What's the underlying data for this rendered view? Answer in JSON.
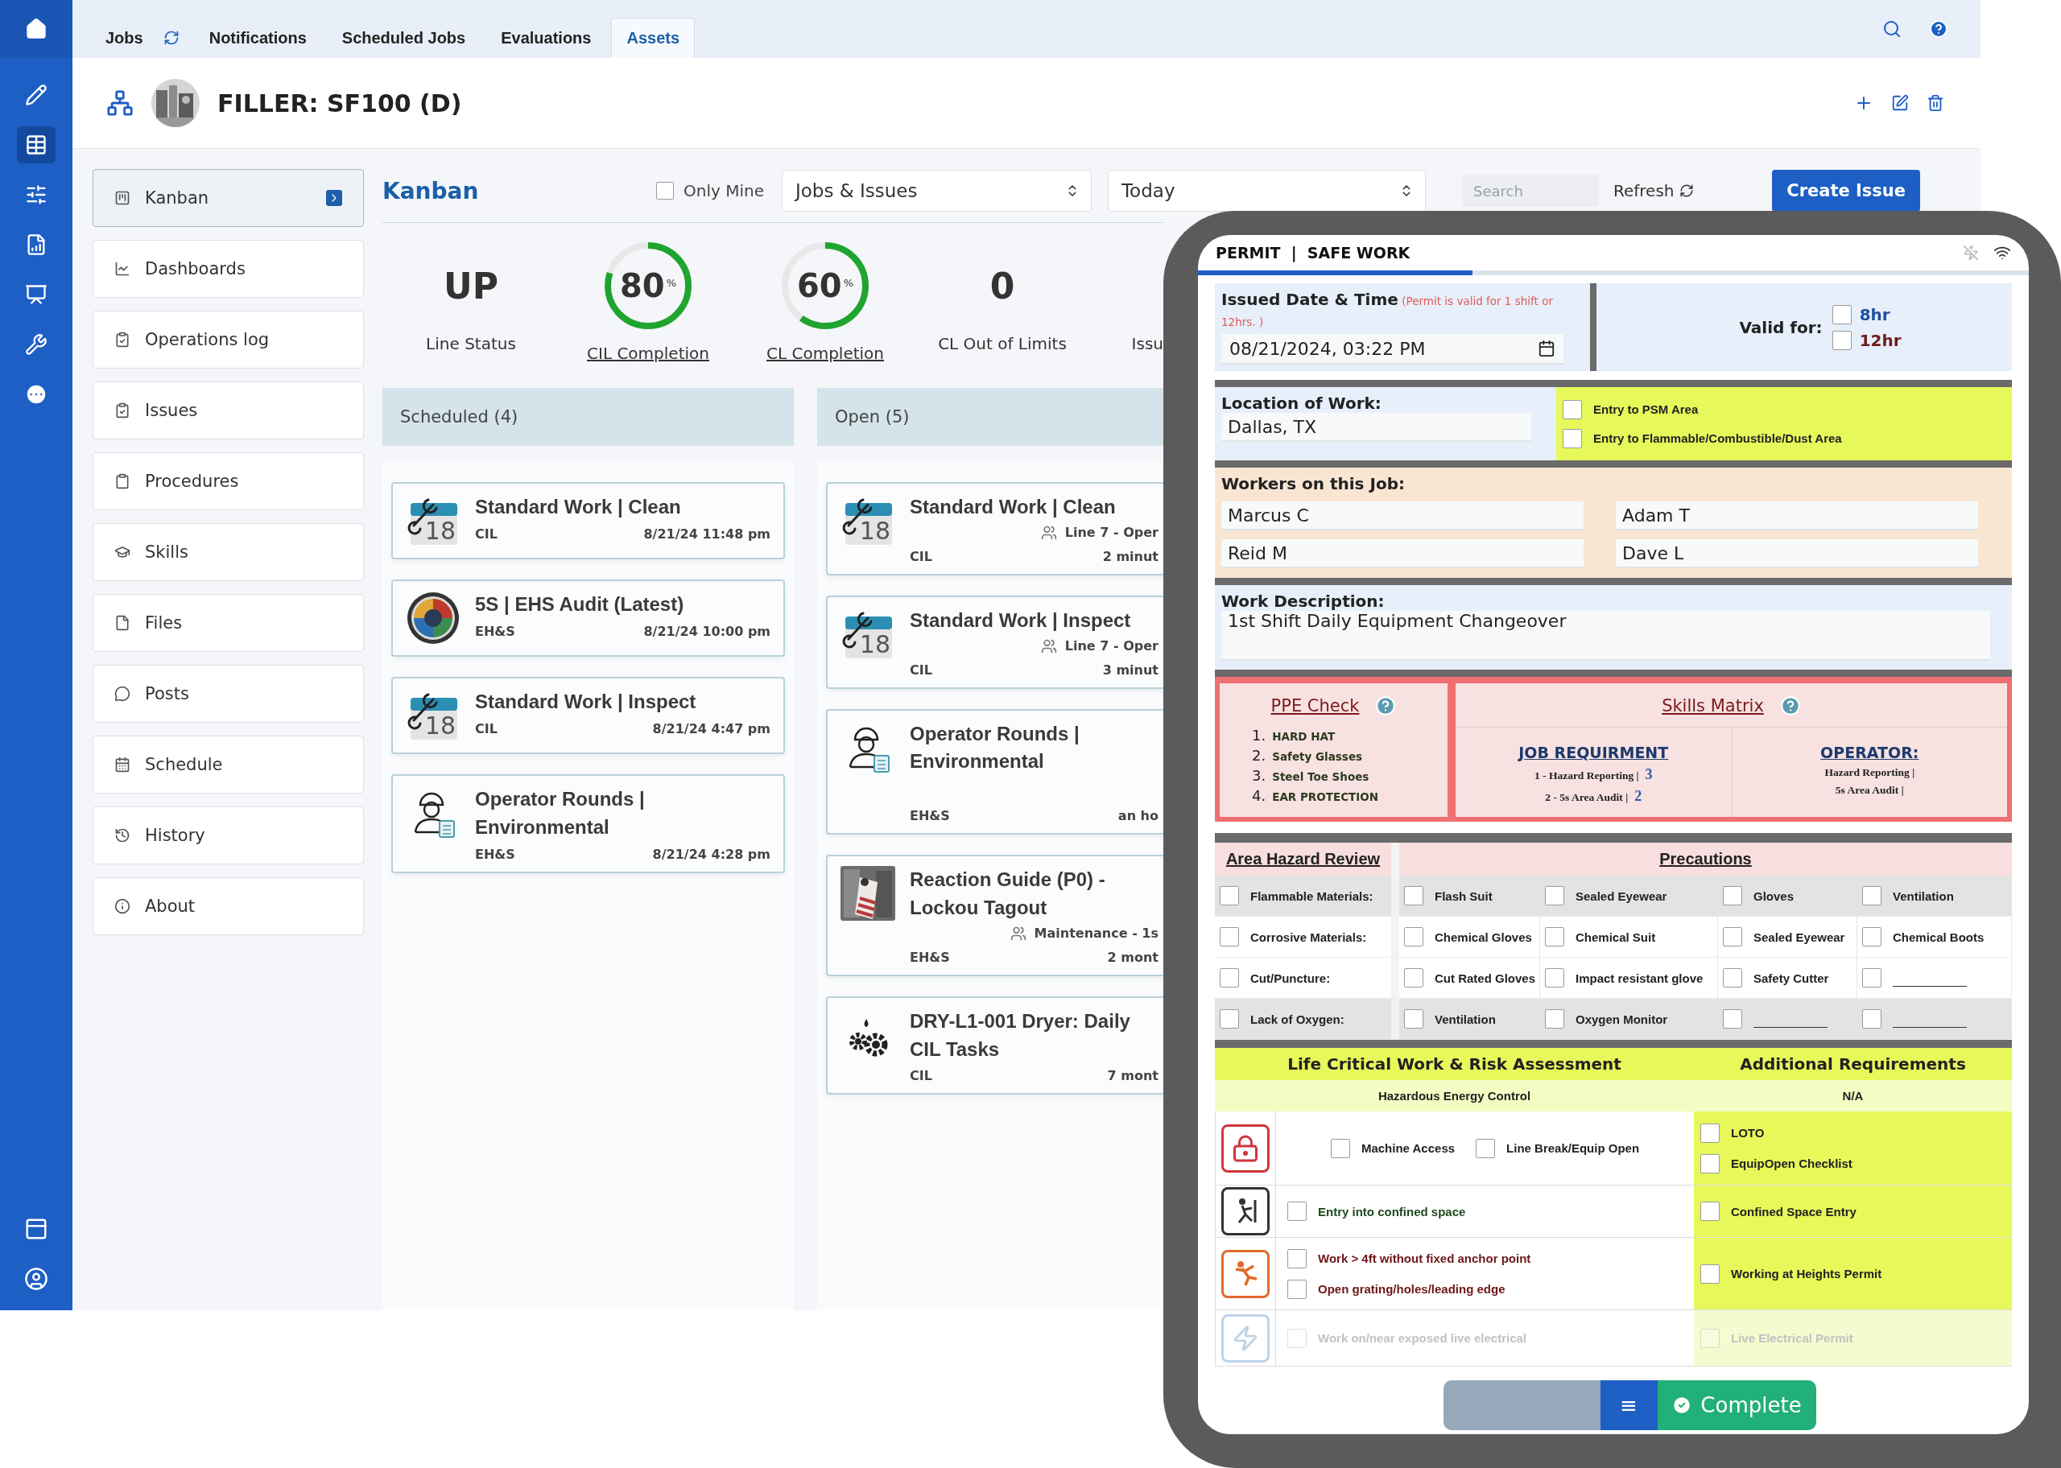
{
  "rail": {
    "top": [
      {
        "selected": false
      },
      {
        "selected": false
      },
      {
        "selected": true
      },
      {
        "selected": false
      },
      {
        "selected": false
      },
      {
        "selected": false
      },
      {
        "selected": false
      },
      {
        "selected": false
      }
    ],
    "bottom": [
      {
        "selected": false
      },
      {
        "selected": false
      }
    ]
  },
  "top_tabs": [
    {
      "label": "Jobs",
      "selected": false
    },
    {
      "label": "Notifications",
      "selected": false
    },
    {
      "label": "Scheduled Jobs",
      "selected": false
    },
    {
      "label": "Evaluations",
      "selected": false
    },
    {
      "label": "Assets",
      "selected": true
    }
  ],
  "header": {
    "title": "FILLER: SF100 (D)"
  },
  "sidebar": [
    {
      "label": "Kanban",
      "selected": true
    },
    {
      "label": "Dashboards",
      "selected": false
    },
    {
      "label": "Operations log",
      "selected": false
    },
    {
      "label": "Issues",
      "selected": false
    },
    {
      "label": "Procedures",
      "selected": false
    },
    {
      "label": "Skills",
      "selected": false
    },
    {
      "label": "Files",
      "selected": false
    },
    {
      "label": "Posts",
      "selected": false
    },
    {
      "label": "Schedule",
      "selected": false
    },
    {
      "label": "History",
      "selected": false
    },
    {
      "label": "About",
      "selected": false
    }
  ],
  "kanban": {
    "title": "Kanban",
    "only_mine": {
      "label": "Only Mine",
      "checked": false
    },
    "selects": [
      "Jobs & Issues",
      "Today"
    ],
    "search": {
      "placeholder": "Search"
    },
    "refresh": "Refresh",
    "create": "Create Issue"
  },
  "stats": [
    {
      "kind": "text",
      "value": "UP",
      "label": "Line Status"
    },
    {
      "kind": "ring",
      "value": "80",
      "unit": "%",
      "level": 0.8,
      "label": "CIL Completion"
    },
    {
      "kind": "ring",
      "value": "60",
      "unit": "%",
      "level": 0.6,
      "label": "CL Completion"
    },
    {
      "kind": "text",
      "value": "0",
      "label": "CL Out of Limits"
    },
    {
      "kind": "partial",
      "label": "Issu"
    }
  ],
  "columns": [
    {
      "title": "Scheduled (4)",
      "cards": [
        {
          "kind": "calendar",
          "date": "18",
          "title": "Standard Work | Clean",
          "tag": "CIL",
          "time": "8/21/24 11:48 pm"
        },
        {
          "kind": "audit",
          "title": "5S | EHS Audit (Latest)",
          "tag": "EH&S",
          "time": "8/21/24 10:00 pm"
        },
        {
          "kind": "calendar",
          "date": "18",
          "title": "Standard Work | Inspect",
          "tag": "CIL",
          "time": "8/21/24 4:47 pm"
        },
        {
          "kind": "operator",
          "title": "Operator Rounds | Environmental",
          "tag": "EH&S",
          "time": "8/21/24 4:28 pm"
        }
      ]
    },
    {
      "title": "Open (5)",
      "cards": [
        {
          "kind": "calendar",
          "date": "18",
          "title": "Standard Work | Clean",
          "team": "Line 7 - Oper",
          "tag": "CIL",
          "time": "2 minut"
        },
        {
          "kind": "calendar",
          "date": "18",
          "title": "Standard Work | Inspect",
          "team": "Line 7 - Oper",
          "tag": "CIL",
          "time": "3 minut"
        },
        {
          "kind": "operator",
          "title": "Operator Rounds | Environmental",
          "tag": "EH&S",
          "time": "an ho"
        },
        {
          "title": "Reaction Guide (P0) - Lockou Tagout",
          "team": "Maintenance - 1s",
          "tag": "EH&S",
          "time": "2 mont"
        },
        {
          "kind": "gears",
          "title": "DRY-L1-001 Dryer: Daily CIL Tasks",
          "tag": "CIL",
          "time": "7 mont"
        }
      ]
    }
  ],
  "permit": {
    "title": "PERMIT  |  SAFE WORK",
    "level": 0.33,
    "issued": {
      "label": "Issued Date & Time",
      "note": "(Permit is valid for 1 shift or 12hrs. )",
      "value": "08/21/2024, 03:22 PM"
    },
    "valid": {
      "label": "Valid for:",
      "options": [
        {
          "label": "8hr",
          "checked": false,
          "color": "#1f4f9e"
        },
        {
          "label": "12hr",
          "checked": false,
          "color": "#6e1c1c"
        }
      ]
    },
    "location": {
      "label": "Location of Work:",
      "value": "Dallas, TX",
      "entries": [
        {
          "label": "Entry to PSM Area",
          "checked": false
        },
        {
          "label": "Entry to Flammable/Combustible/Dust Area",
          "checked": false
        }
      ]
    },
    "workers": {
      "label": "Workers on this Job:",
      "names": [
        "Marcus C",
        "Adam T",
        "Reid M",
        "Dave L"
      ]
    },
    "description": {
      "label": "Work Description:",
      "value": "1st Shift Daily Equipment Changeover"
    },
    "ppe": {
      "title": "PPE Check",
      "items": [
        {
          "num": "1.",
          "text": "HARD HAT"
        },
        {
          "num": "2.",
          "text": "Safety Glasses"
        },
        {
          "num": "3.",
          "text": "Steel Toe Shoes"
        },
        {
          "num": "4.",
          "text": "EAR PROTECTION"
        }
      ]
    },
    "skills": {
      "title": "Skills Matrix",
      "job": {
        "title": "JOB REQUIRMENT",
        "rows": [
          {
            "text": "1 - Hazard Reporting |",
            "value": "3"
          },
          {
            "text": "2 - 5s Area Audit |",
            "value": "2"
          }
        ]
      },
      "operator": {
        "title": "OPERATOR:",
        "rows": [
          "Hazard Reporting |",
          "5s Area Audit |"
        ]
      }
    },
    "hazards": {
      "title": "Area Hazard Review",
      "precautions_title": "Precautions",
      "rows": [
        {
          "hazard": {
            "label": "Flammable Materials:",
            "checked": false
          },
          "precautions": [
            {
              "label": "Flash Suit",
              "checked": false
            },
            {
              "label": "Sealed Eyewear",
              "checked": false
            },
            {
              "label": "Gloves",
              "checked": false
            },
            {
              "label": "Ventilation",
              "checked": false
            }
          ]
        },
        {
          "hazard": {
            "label": "Corrosive Materials:",
            "checked": false
          },
          "precautions": [
            {
              "label": "Chemical Gloves",
              "checked": false
            },
            {
              "label": "Chemical Suit",
              "checked": false
            },
            {
              "label": "Sealed Eyewear",
              "checked": false
            },
            {
              "label": "Chemical Boots",
              "checked": false
            }
          ]
        },
        {
          "hazard": {
            "label": "Cut/Puncture:",
            "checked": false
          },
          "precautions": [
            {
              "label": "Cut Rated Gloves",
              "checked": false
            },
            {
              "label": "Impact resistant glove",
              "checked": false
            },
            {
              "label": "Safety Cutter",
              "checked": false
            },
            {
              "checked": false
            }
          ]
        },
        {
          "hazard": {
            "label": "Lack of Oxygen:",
            "checked": false
          },
          "precautions": [
            {
              "label": "Ventilation",
              "checked": false
            },
            {
              "label": "Oxygen Monitor",
              "checked": false
            },
            {
              "checked": false
            },
            {
              "checked": false
            }
          ]
        }
      ]
    },
    "life": {
      "title": "Life Critical Work & Risk Assessment",
      "additional_title": "Additional Requirements",
      "sub_left": "Hazardous Energy Control",
      "sub_right": "N/A",
      "rows": [
        {
          "kind": "lock",
          "color": "#222222",
          "faded": false,
          "items": [
            {
              "label": "Machine Access",
              "checked": false
            },
            {
              "label": "Line Break/Equip Open",
              "checked": false
            }
          ],
          "inline": true,
          "requirements": [
            {
              "label": "LOTO",
              "checked": false
            },
            {
              "label": "EquipOpen Checklist",
              "checked": false
            }
          ]
        },
        {
          "kind": "confined",
          "color": "#1f4a1f",
          "faded": false,
          "items": [
            {
              "label": "Entry into confined space",
              "checked": false
            }
          ],
          "inline": false,
          "requirements": [
            {
              "label": "Confined Space Entry",
              "checked": false
            }
          ]
        },
        {
          "kind": "fall",
          "color": "#6e1616",
          "faded": false,
          "items": [
            {
              "label": "Work > 4ft without fixed anchor point",
              "checked": false
            },
            {
              "label": "Open grating/holes/leading edge",
              "checked": false
            }
          ],
          "inline": false,
          "requirements": [
            {
              "label": "Working at Heights Permit",
              "checked": false
            }
          ]
        },
        {
          "kind": "electric",
          "color": "#c2c2c2",
          "faded": true,
          "items": [
            {
              "label": "Work on/near exposed live electrical",
              "checked": false
            }
          ],
          "inline": false,
          "requirements": [
            {
              "label": "Live Electrical Permit",
              "checked": false
            }
          ]
        }
      ]
    },
    "footer": {
      "menu": "≡",
      "complete": "Complete"
    }
  }
}
